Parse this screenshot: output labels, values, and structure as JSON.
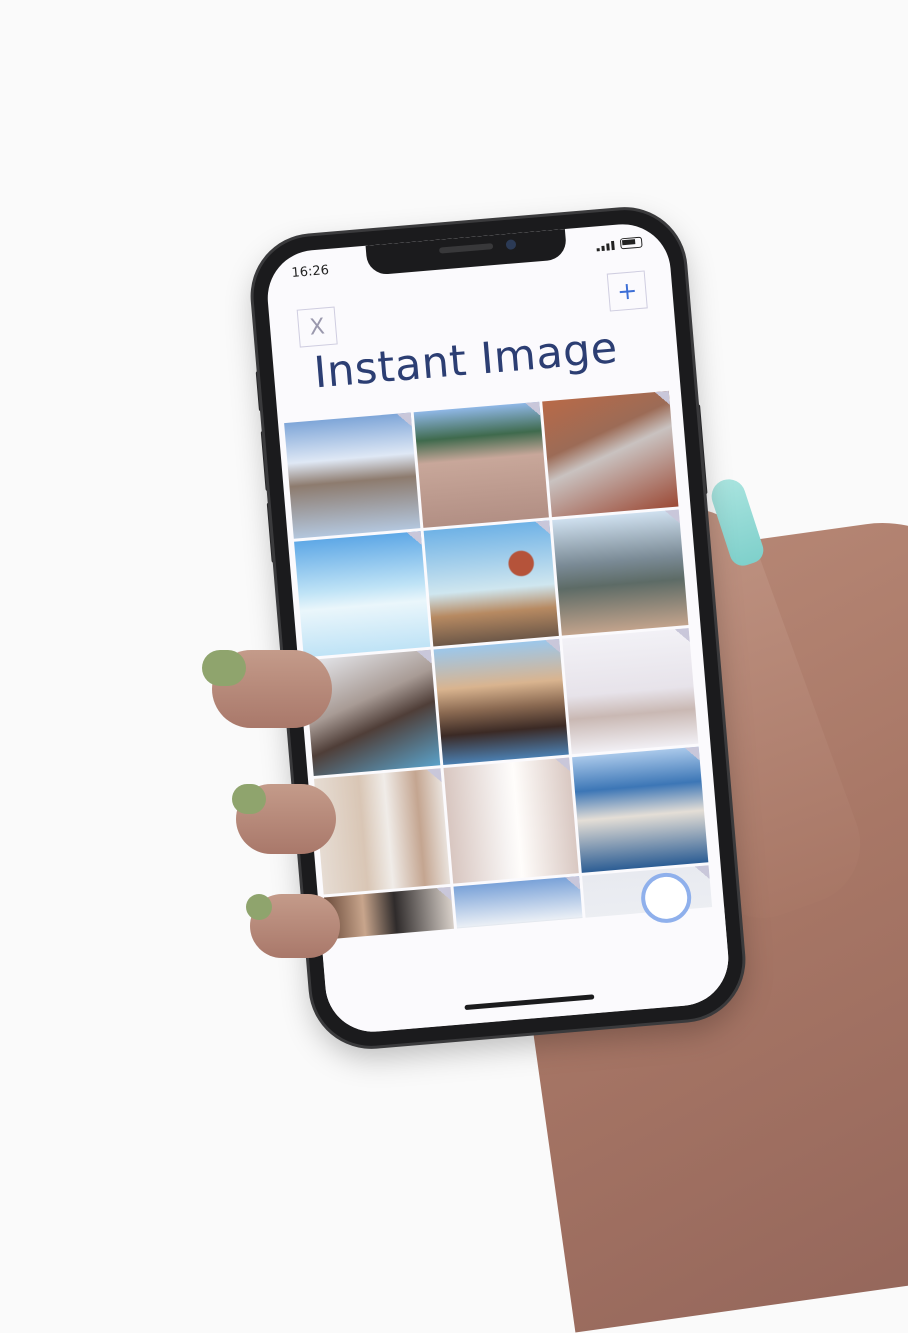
{
  "status_bar": {
    "time": "16:26"
  },
  "toolbar": {
    "close_label": "X",
    "add_label": "+"
  },
  "app": {
    "title": "Instant Image"
  },
  "colors": {
    "title": "#2c3e73",
    "add_accent": "#3d6fd6",
    "shutter_ring": "#8fb0ec",
    "nail": "#8fd8d2"
  },
  "gallery": {
    "tiles": [
      {
        "name": "photo-lake-mountains",
        "bg": "linear-gradient(180deg,#7fa6d8 0%,#dfe8f5 35%,#8d7b6e 55%,#b3c6dd 100%)"
      },
      {
        "name": "photo-salt-terraces",
        "bg": "linear-gradient(180deg,#8fb7e6 0%,#3f6a4d 25%,#c8a79a 45%,#b28f84 100%)"
      },
      {
        "name": "photo-canyon-road",
        "bg": "linear-gradient(160deg,#b86a48 0%,#9c6b56 35%,#c9c2c0 50%,#9c4a36 100%)"
      },
      {
        "name": "photo-infinity-pool",
        "bg": "linear-gradient(180deg,#5fa8e6 0%,#bfe3f6 45%,#eaf6fb 60%,#bfe3f6 100%)"
      },
      {
        "name": "photo-hot-air-balloon",
        "bg": "radial-gradient(circle at 75% 35%,#b5533a 0 10%,transparent 11%),linear-gradient(180deg,#6fb2e6 0%,#cfe6ef 55%,#b78a62 75%,#6d5848 100%)"
      },
      {
        "name": "photo-great-wall",
        "bg": "linear-gradient(180deg,#cfe0ef 0%,#7a8a95 40%,#5d6b66 60%,#c2a38c 100%)"
      },
      {
        "name": "photo-snowy-valley",
        "bg": "linear-gradient(160deg,#e7e9ee 0%,#a89b95 40%,#4f3e38 60%,#5aa1c9 100%)"
      },
      {
        "name": "photo-parthenon-woman",
        "bg": "linear-gradient(180deg,#9cc7ea 0%,#d9b48f 35%,#8b6a52 55%,#3b2a25 75%,#4b7fb0 100%)"
      },
      {
        "name": "photo-white-mosque",
        "bg": "linear-gradient(180deg,#f2f1f6 0%,#e7e3ea 50%,#c9b8b3 70%,#f1eff4 100%)"
      },
      {
        "name": "photo-woman-columns",
        "bg": "linear-gradient(90deg,#e6dcd3 0%,#d9c6b5 35%,#f0ece8 55%,#c4a590 80%,#e9e2dc 100%)"
      },
      {
        "name": "photo-arched-corridor",
        "bg": "linear-gradient(90deg,#d8c6c0 0%,#f7f4f3 45%,#fffdfb 55%,#d9c8c2 100%)"
      },
      {
        "name": "photo-coastal-rocks",
        "bg": "linear-gradient(180deg,#a9c8ea 0%,#3c76b6 30%,#e4ded6 55%,#2c5d94 100%)"
      },
      {
        "name": "photo-market-street",
        "bg": "linear-gradient(90deg,#6b4b3b 0%,#c8a58c 30%,#2f2b2b 55%,#d7cfc8 100%)"
      },
      {
        "name": "photo-snow-mountains",
        "bg": "linear-gradient(180deg,#7aa2d8 0%,#e9eef5 35%,#6b6660 55%,#a38d7a 100%)"
      },
      {
        "name": "photo-misty-sea",
        "bg": "linear-gradient(180deg,#e8eaf0 0%,#eef0f4 60%,#d4dae4 100%)"
      }
    ]
  }
}
